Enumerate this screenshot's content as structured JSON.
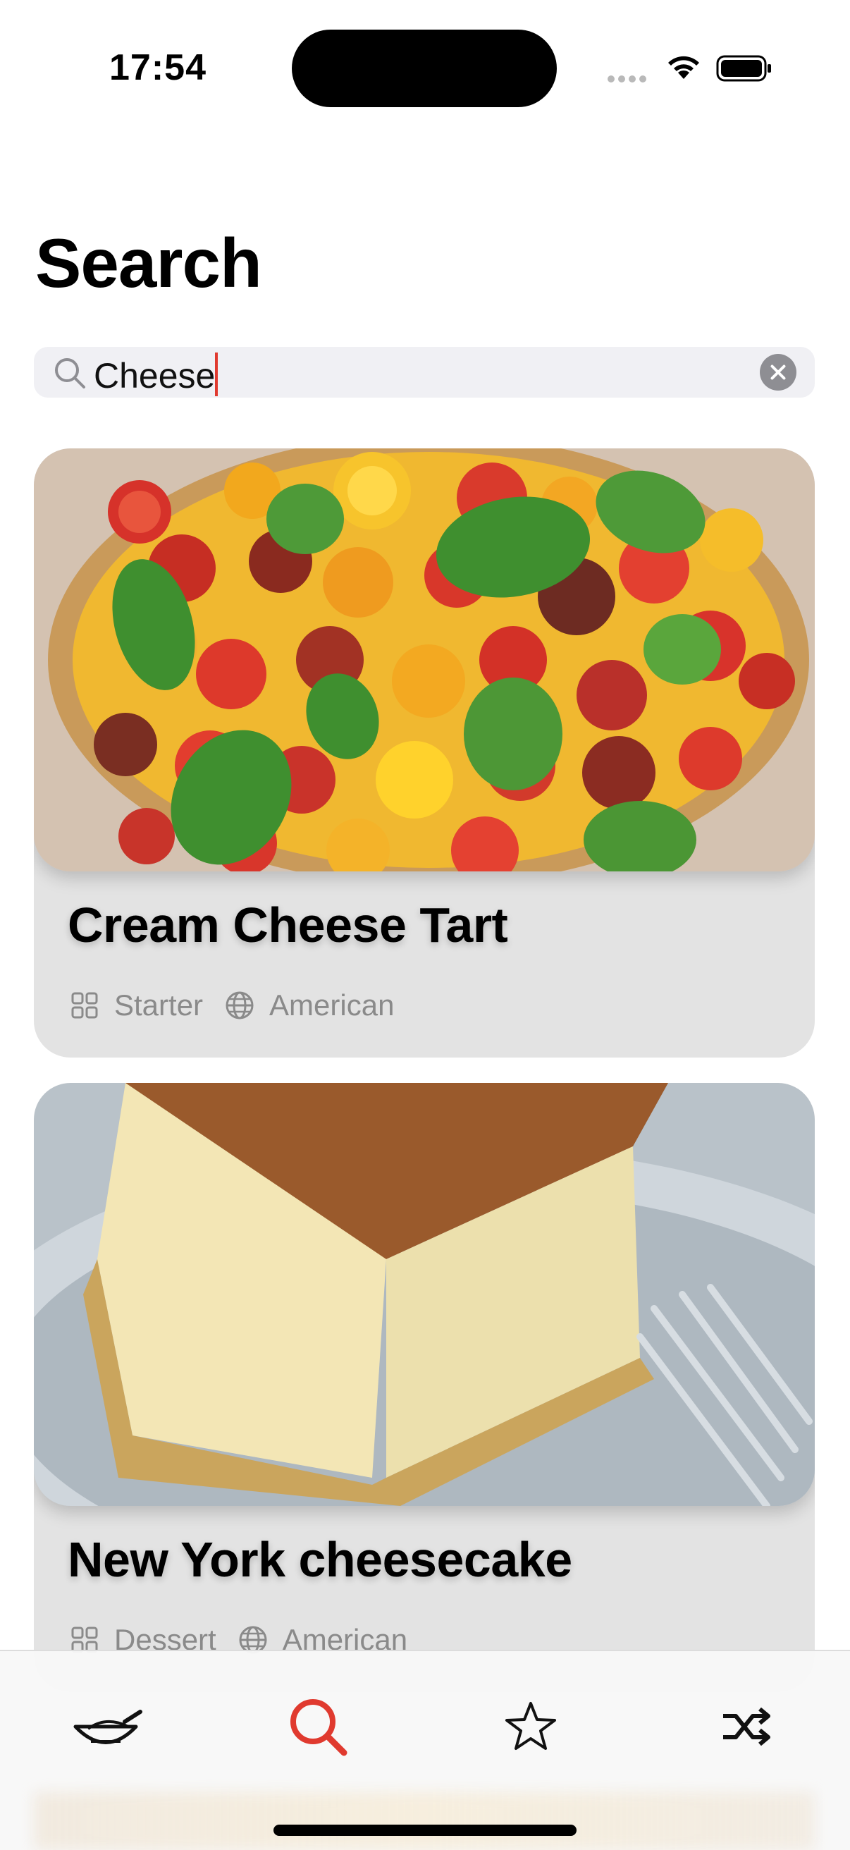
{
  "status_bar": {
    "time": "17:54"
  },
  "page": {
    "title": "Search"
  },
  "search": {
    "value": "Cheese"
  },
  "results": [
    {
      "title": "Cream Cheese Tart",
      "course": "Starter",
      "cuisine": "American",
      "image": "tomato-basil-tart-photo"
    },
    {
      "title": "New York cheesecake",
      "course": "Dessert",
      "cuisine": "American",
      "image": "cheesecake-slice-photo"
    }
  ],
  "tab_bar": {
    "tabs": [
      "pot-icon",
      "search-icon",
      "star-icon",
      "shuffle-icon"
    ],
    "active": "search-icon"
  },
  "colors": {
    "accent": "#e03a2f",
    "card_bg": "#e3e3e3",
    "meta_text": "#8a8a8a"
  }
}
